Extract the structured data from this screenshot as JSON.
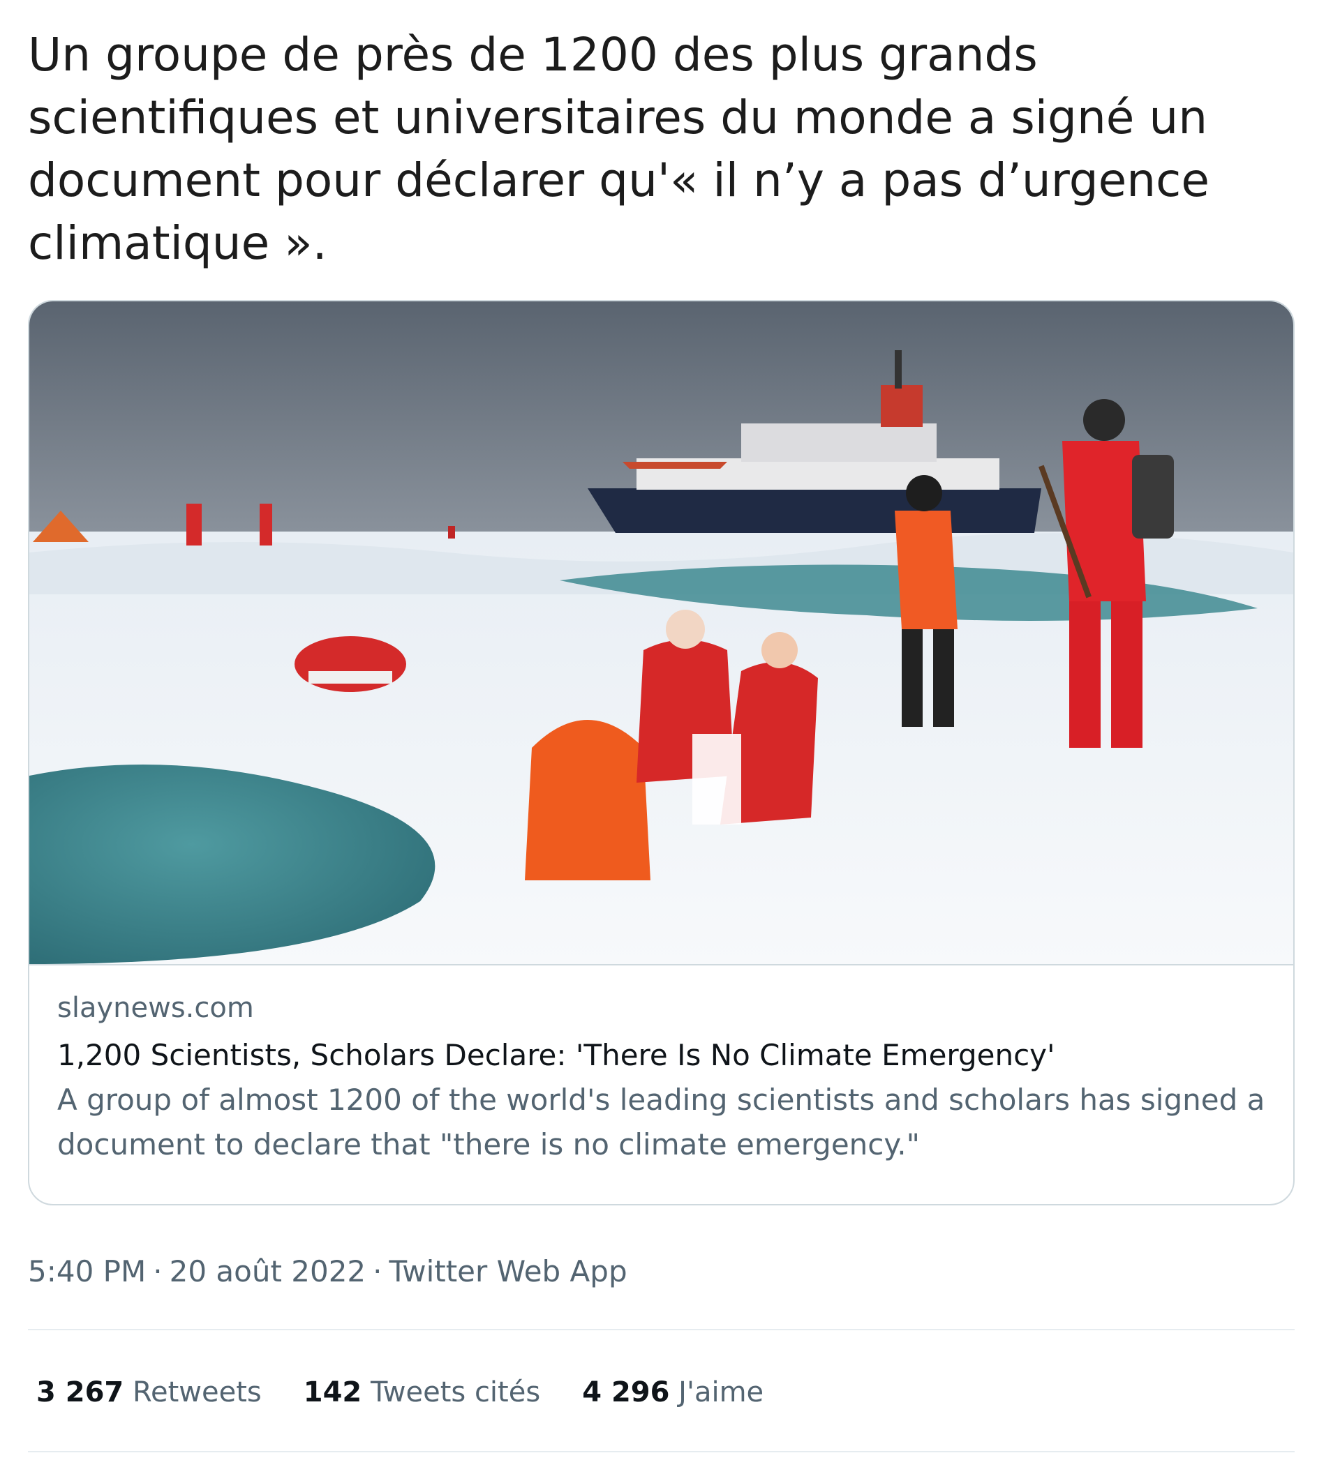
{
  "tweet": {
    "text": "Un groupe de près de 1200 des plus grands scientifiques et universitaires du monde a signé un document pour déclarer qu'« il n’y a pas d’urgence climatique »."
  },
  "card": {
    "image_icon": "photo-arctic-scientists-icebreaker",
    "domain": "slaynews.com",
    "title": "1,200 Scientists, Scholars Declare: 'There Is No Climate Emergency'",
    "description": "A group of almost 1200 of the world's leading scientists and scholars has signed a document to declare that \"there is no climate emergency.\""
  },
  "meta": {
    "time": "5:40 PM",
    "separator": "·",
    "date": "20 août 2022",
    "source": "Twitter Web App"
  },
  "stats": {
    "retweets_count": "3 267",
    "retweets_label": "Retweets",
    "quotes_count": "142",
    "quotes_label": "Tweets cités",
    "likes_count": "4 296",
    "likes_label": "J'aime"
  },
  "colors": {
    "text_primary": "#0f1419",
    "text_secondary": "#536471",
    "border": "#cfd9de"
  }
}
